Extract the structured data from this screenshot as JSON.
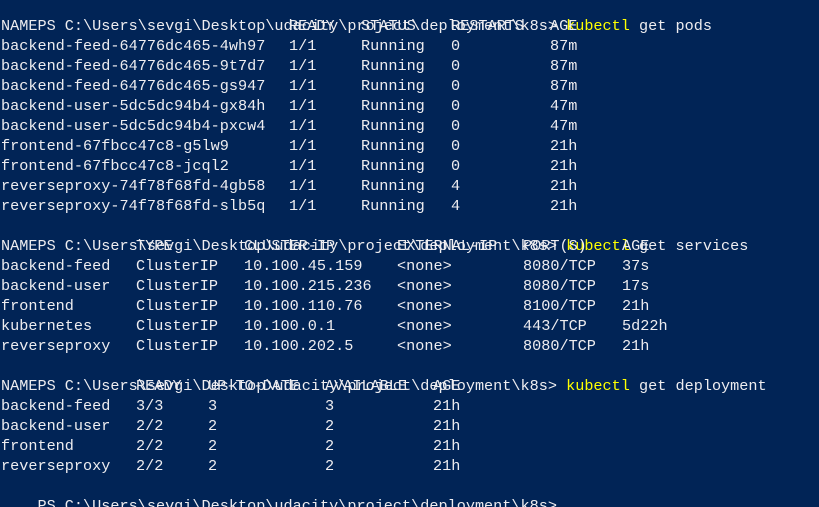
{
  "prompt": "PS C:\\Users\\sevgi\\Desktop\\udacity\\project\\deployment\\k8s>",
  "command_1": {
    "program": "kubectl",
    "args": "get pods"
  },
  "command_2": {
    "program": "kubectl",
    "args": "get services"
  },
  "command_3": {
    "program": "kubectl",
    "args": "get deployment"
  },
  "pods": {
    "headers": [
      "NAME",
      "READY",
      "STATUS",
      "RESTARTS",
      "AGE"
    ],
    "rows": [
      [
        "backend-feed-64776dc465-4wh97",
        "1/1",
        "Running",
        "0",
        "87m"
      ],
      [
        "backend-feed-64776dc465-9t7d7",
        "1/1",
        "Running",
        "0",
        "87m"
      ],
      [
        "backend-feed-64776dc465-gs947",
        "1/1",
        "Running",
        "0",
        "87m"
      ],
      [
        "backend-user-5dc5dc94b4-gx84h",
        "1/1",
        "Running",
        "0",
        "47m"
      ],
      [
        "backend-user-5dc5dc94b4-pxcw4",
        "1/1",
        "Running",
        "0",
        "47m"
      ],
      [
        "frontend-67fbcc47c8-g5lw9",
        "1/1",
        "Running",
        "0",
        "21h"
      ],
      [
        "frontend-67fbcc47c8-jcql2",
        "1/1",
        "Running",
        "0",
        "21h"
      ],
      [
        "reverseproxy-74f78f68fd-4gb58",
        "1/1",
        "Running",
        "4",
        "21h"
      ],
      [
        "reverseproxy-74f78f68fd-slb5q",
        "1/1",
        "Running",
        "4",
        "21h"
      ]
    ]
  },
  "services": {
    "headers": [
      "NAME",
      "TYPE",
      "CLUSTER-IP",
      "EXTERNAL-IP",
      "PORT(S)",
      "AGE"
    ],
    "rows": [
      [
        "backend-feed",
        "ClusterIP",
        "10.100.45.159",
        "<none>",
        "8080/TCP",
        "37s"
      ],
      [
        "backend-user",
        "ClusterIP",
        "10.100.215.236",
        "<none>",
        "8080/TCP",
        "17s"
      ],
      [
        "frontend",
        "ClusterIP",
        "10.100.110.76",
        "<none>",
        "8100/TCP",
        "21h"
      ],
      [
        "kubernetes",
        "ClusterIP",
        "10.100.0.1",
        "<none>",
        "443/TCP",
        "5d22h"
      ],
      [
        "reverseproxy",
        "ClusterIP",
        "10.100.202.5",
        "<none>",
        "8080/TCP",
        "21h"
      ]
    ]
  },
  "deployments": {
    "headers": [
      "NAME",
      "READY",
      "UP-TO-DATE",
      "AVAILABLE",
      "AGE"
    ],
    "rows": [
      [
        "backend-feed",
        "3/3",
        "3",
        "3",
        "21h"
      ],
      [
        "backend-user",
        "2/2",
        "2",
        "2",
        "21h"
      ],
      [
        "frontend",
        "2/2",
        "2",
        "2",
        "21h"
      ],
      [
        "reverseproxy",
        "2/2",
        "2",
        "2",
        "21h"
      ]
    ]
  },
  "colors": {
    "background": "#012456",
    "text": "#eeedf0",
    "command": "#ffff00"
  }
}
